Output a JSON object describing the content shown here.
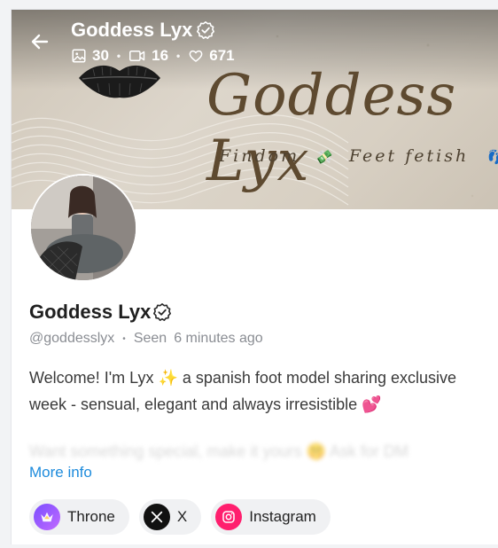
{
  "header": {
    "name": "Goddess Lyx",
    "stats": {
      "photos": "30",
      "videos": "16",
      "likes": "671"
    }
  },
  "banner": {
    "script_title": "Goddess Lyx",
    "subtitle_left": "Findom",
    "subtitle_emoji_1": "💸",
    "subtitle_right": "Feet fetish",
    "subtitle_emoji_2": "👣"
  },
  "profile": {
    "name": "Goddess Lyx",
    "handle": "@goddesslyx",
    "seen_label": "Seen",
    "seen_time": "6 minutes ago",
    "bio_line1": "Welcome! I'm Lyx ✨ a spanish foot model sharing exclusive",
    "bio_line2": "week - sensual, elegant and always irresistible 💕",
    "bio_faded": "Want something special, make it yours 🤫 Ask for DM",
    "more_info": "More info"
  },
  "links": [
    {
      "label": "Throne",
      "icon": "throne-icon"
    },
    {
      "label": "X",
      "icon": "x-icon"
    },
    {
      "label": "Instagram",
      "icon": "instagram-icon"
    }
  ],
  "colors": {
    "accent_link": "#1d8bdc",
    "instagram": "#ff1f6e",
    "throne": "#7a4dff"
  }
}
